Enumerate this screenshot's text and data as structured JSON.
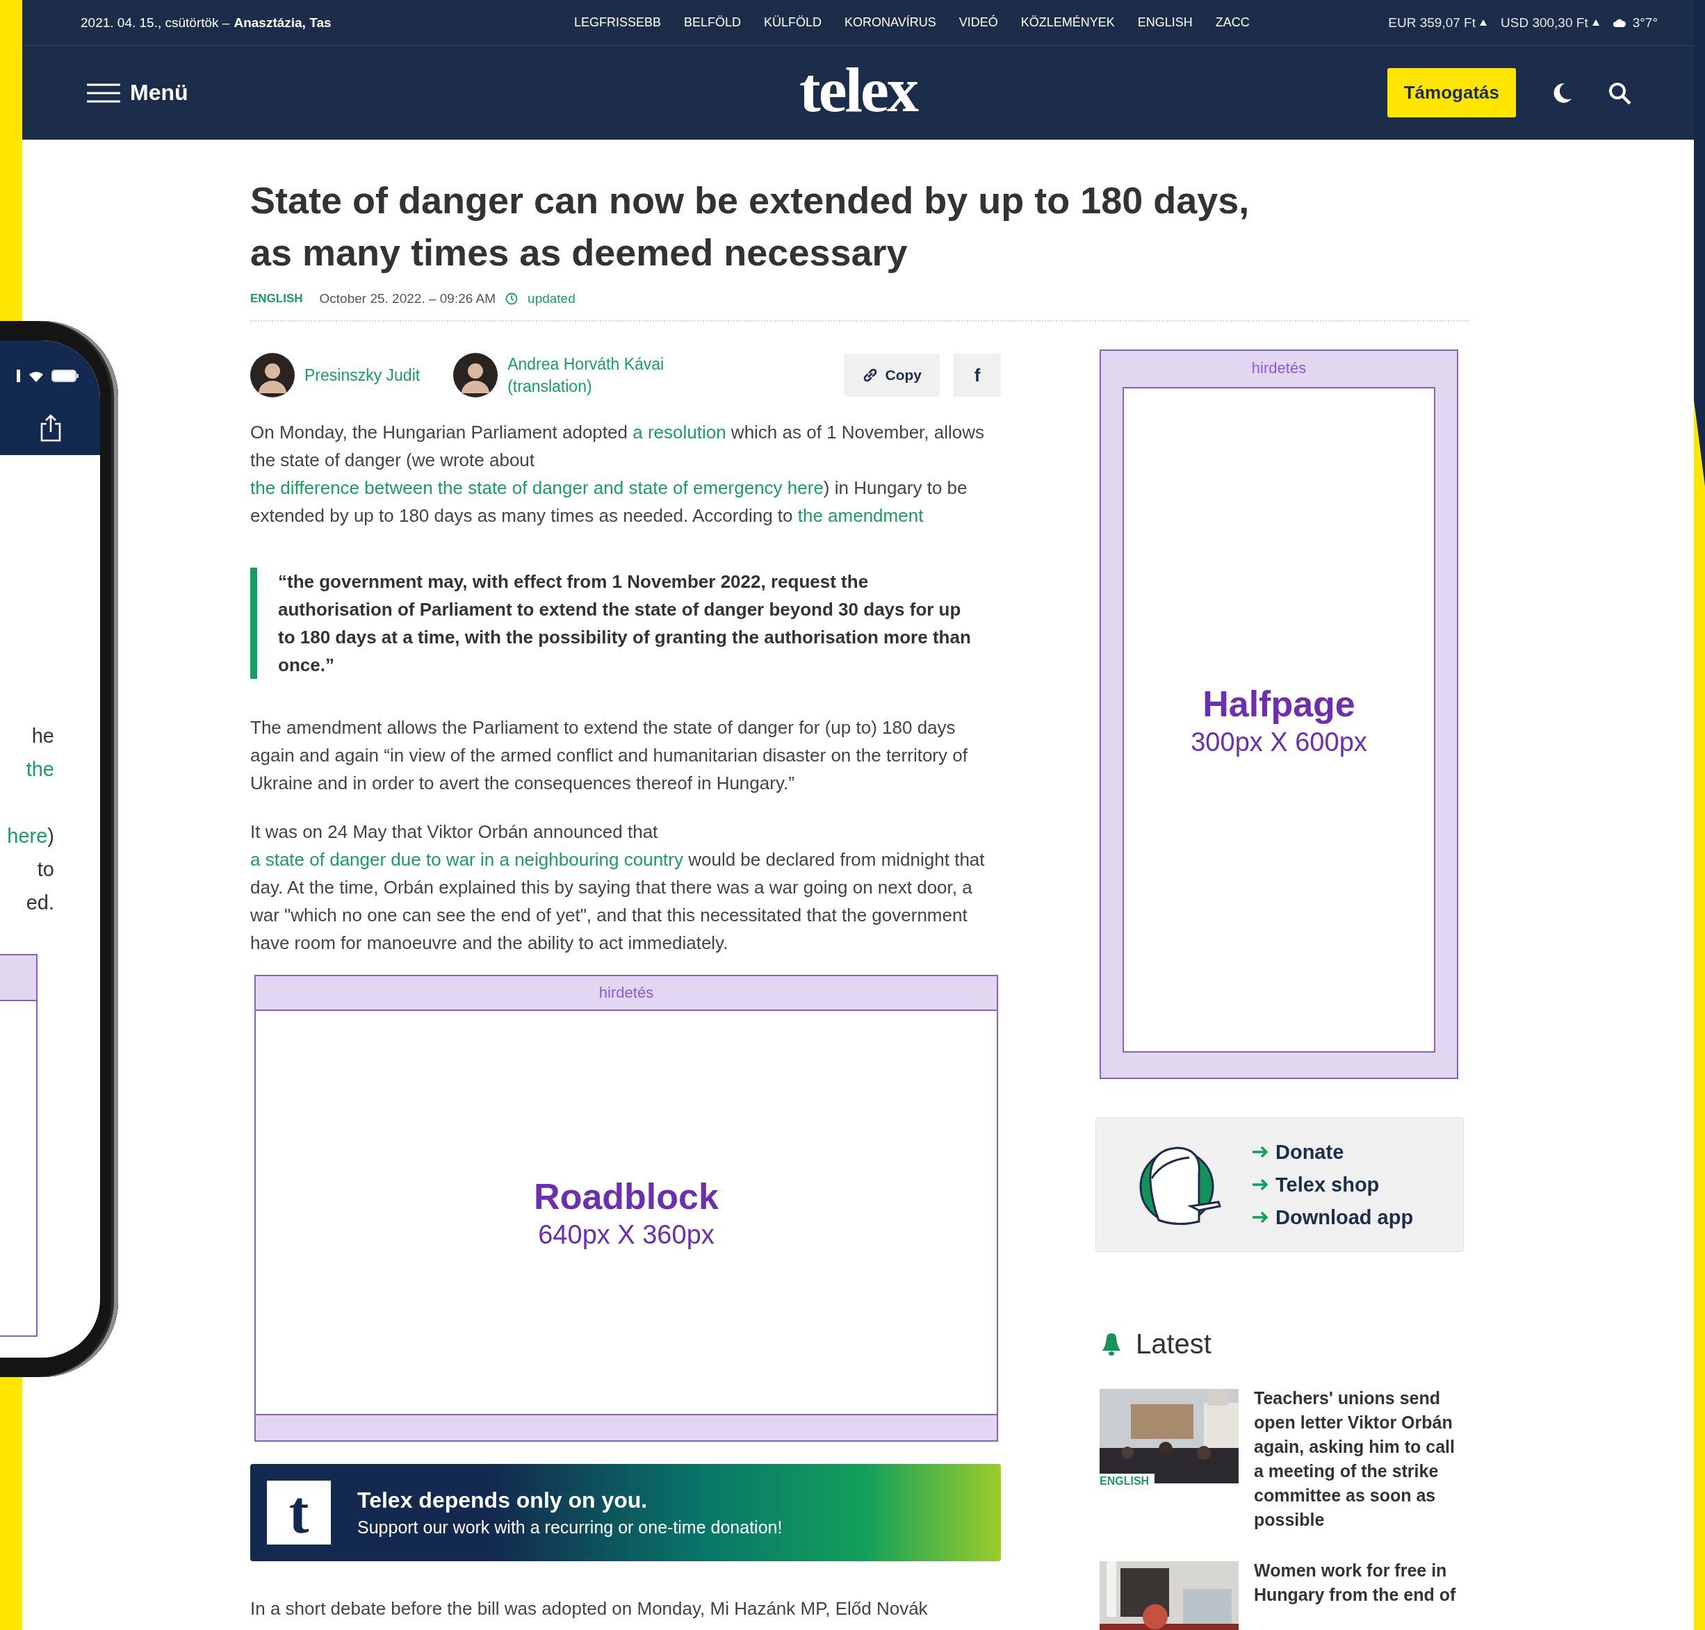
{
  "topbar": {
    "date": "2021. 04. 15., csütörtök –",
    "namedays": "Anasztázia, Tas",
    "nav": [
      "LEGFRISSEBB",
      "BELFÖLD",
      "KÜLFÖLD",
      "KORONAVÍRUS",
      "VIDEÓ",
      "KÖZLEMÉNYEK",
      "ENGLISH",
      "ZACC"
    ],
    "rates": [
      "EUR 359,07 Ft",
      "USD 300,30 Ft"
    ],
    "weather": "3°7°"
  },
  "header": {
    "menu": "Menü",
    "logo": "telex",
    "support": "Támogatás"
  },
  "article": {
    "title": "State of danger can now be extended by up to 180 days, as many times as deemed necessary",
    "category": "ENGLISH",
    "date": "October 25. 2022. – 09:26 AM",
    "updated": "updated",
    "authors": [
      {
        "name": "Presinszky Judit"
      },
      {
        "name": "Andrea Horváth Kávai",
        "role": "(translation)"
      }
    ],
    "share": {
      "copy": "Copy",
      "facebook": "f"
    },
    "intro": [
      {
        "text": "On Monday, the Hungarian Parliament adopted ",
        "link": false
      },
      {
        "text": "a resolution",
        "link": true
      },
      {
        "text": " which as of 1 November, allows the state of danger (we wrote about ",
        "link": false
      },
      {
        "text": "the difference between the state of danger and state of emergency here",
        "link": true
      },
      {
        "text": ") in Hungary to be extended by up to 180 days as many times as needed. According to ",
        "link": false
      },
      {
        "text": "the amendment",
        "link": true
      }
    ],
    "quote": "“the government may, with effect from 1 November 2022, request the authorisation of Parliament to extend the state of danger beyond 30 days for up to 180 days at a time, with the possibility of granting the authorisation more than once.”",
    "paragraphs": [
      [
        {
          "text": "The amendment allows the Parliament to extend the state of danger for (up to) 180 days again and again “in view of the armed conflict and humanitarian disaster on the territory of Ukraine and in order to avert the consequences thereof in Hungary.”",
          "link": false
        }
      ],
      [
        {
          "text": "It was on 24 May that Viktor Orbán announced that ",
          "link": false
        },
        {
          "text": "a state of danger due to war in a neighbouring country",
          "link": true
        },
        {
          "text": " would be declared from midnight that day. At the time, Orbán explained this by saying that there was a war going on next door, a war \"which no one can see the end of yet\", and that this necessitated that the government have room for manoeuvre and the ability to act immediately.",
          "link": false
        }
      ]
    ],
    "ad": {
      "label": "hirdetés",
      "name": "Roadblock",
      "size": "640px X 360px"
    },
    "banner": {
      "logo": "t",
      "title": "Telex depends only on you.",
      "text": "Support our work with a recurring or one-time donation!"
    },
    "closing": "In a short debate before the bill was adopted on Monday, Mi Hazánk MP, Előd Novák"
  },
  "sidebar": {
    "ad": {
      "label": "hirdetés",
      "name": "Halfpage",
      "size": "300px X 600px"
    },
    "links": [
      "Donate",
      "Telex shop",
      "Download app"
    ],
    "latest": {
      "title": "Latest",
      "items": [
        {
          "category": "ENGLISH",
          "title": "Teachers' unions send open letter Viktor Orbán again, asking him to call a meeting of the strike committee as soon as possible"
        },
        {
          "title": "Women work for free in Hungary from the end of"
        }
      ]
    }
  },
  "phone": {
    "lines": [
      [
        {
          "text": "he",
          "link": false
        }
      ],
      [
        {
          "text": "the",
          "link": true
        }
      ],
      [
        {
          "text": "here",
          "link": true
        },
        {
          "text": ")",
          "link": false
        }
      ],
      [
        {
          "text": "to",
          "link": false
        }
      ],
      [
        {
          "text": "ed.",
          "link": false
        }
      ]
    ]
  }
}
